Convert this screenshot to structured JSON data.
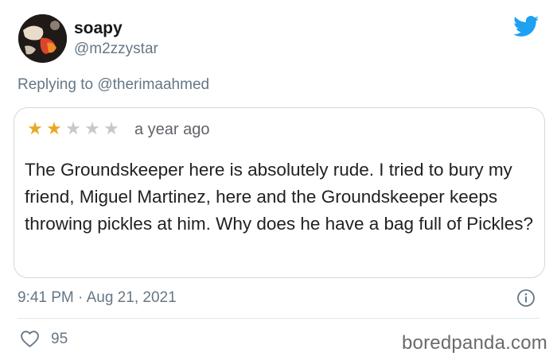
{
  "author": {
    "display_name": "soapy",
    "handle": "@m2zzystar",
    "avatar_icon": "avatar-icon"
  },
  "brand": {
    "logo_icon": "twitter-bird-icon",
    "color": "#1da1f2"
  },
  "reply": {
    "prefix": "Replying to",
    "mention": "@therimaahmed"
  },
  "review": {
    "rating": 2,
    "max_rating": 5,
    "star_color": "#e9a825",
    "time_ago": "a year ago",
    "text": "The Groundskeeper here is absolutely rude. I tried to bury my friend, Miguel Martinez, here and the Groundskeeper keeps throwing pickles at him. Why does he have a bag full of Pickles?"
  },
  "meta": {
    "timestamp": "9:41 PM · Aug 21, 2021",
    "info_icon": "info-icon"
  },
  "actions": {
    "like_count": "95",
    "like_icon": "heart-icon"
  },
  "watermark": "boredpanda.com"
}
